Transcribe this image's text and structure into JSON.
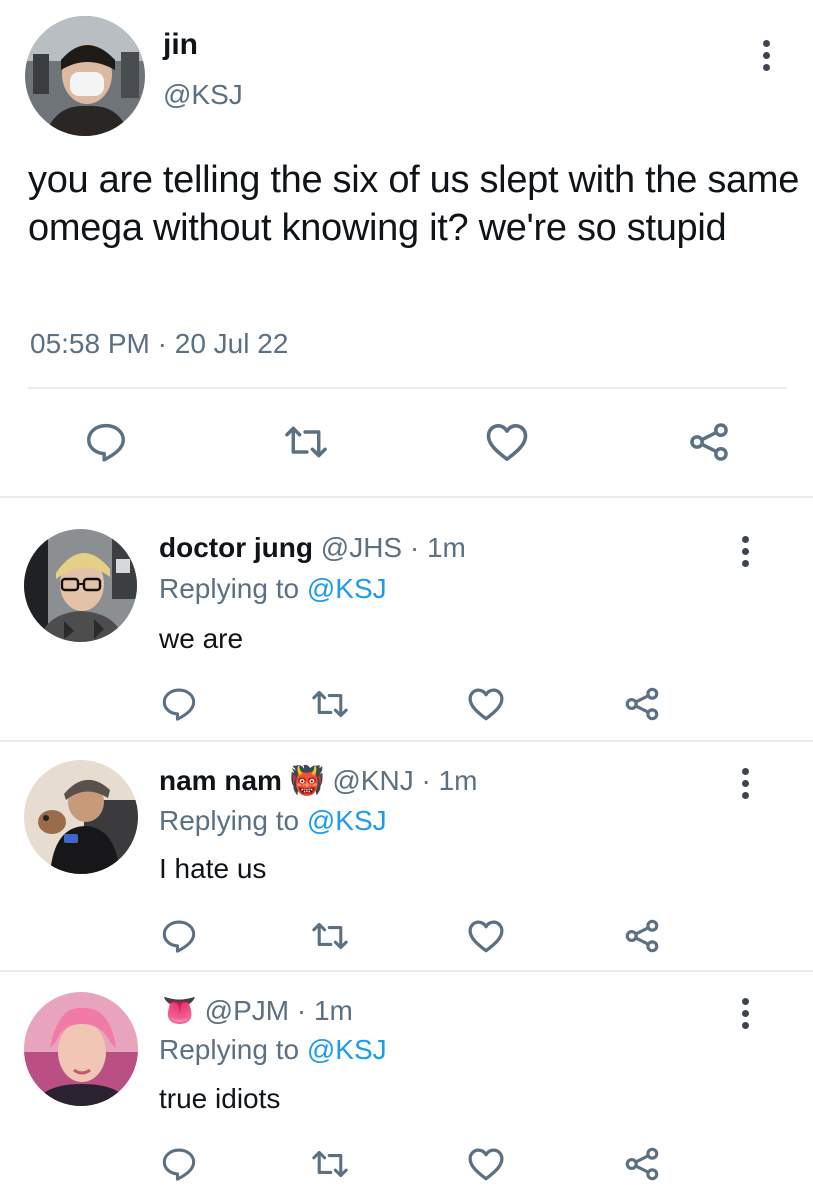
{
  "main_tweet": {
    "display_name": "jin",
    "handle": "@KSJ",
    "text": "you are telling the six of us slept with the same omega without knowing it? we're so stupid",
    "time": "05:58 PM",
    "separator": "·",
    "date": "20 Jul 22"
  },
  "replies": [
    {
      "display_name": "doctor jung",
      "emoji": "",
      "handle": "@JHS",
      "time": "· 1m",
      "replying_label": "Replying to",
      "replying_to": "@KSJ",
      "text": "we are"
    },
    {
      "display_name": "nam nam",
      "emoji": "👹",
      "handle": "@KNJ",
      "time": "· 1m",
      "replying_label": "Replying to",
      "replying_to": "@KSJ",
      "text": "I hate us"
    },
    {
      "display_name": "",
      "emoji": "👅",
      "handle": "@PJM",
      "time": "· 1m",
      "replying_label": "Replying to",
      "replying_to": "@KSJ",
      "text": "true idiots"
    }
  ],
  "icons": {
    "actions": [
      "reply-icon",
      "retweet-icon",
      "like-icon",
      "share-icon"
    ],
    "menu": "more-options-icon"
  },
  "colors": {
    "link": "#1d9bf0",
    "muted": "#5b7083",
    "icon": "#5b7083",
    "divider": "#e8ecef"
  }
}
